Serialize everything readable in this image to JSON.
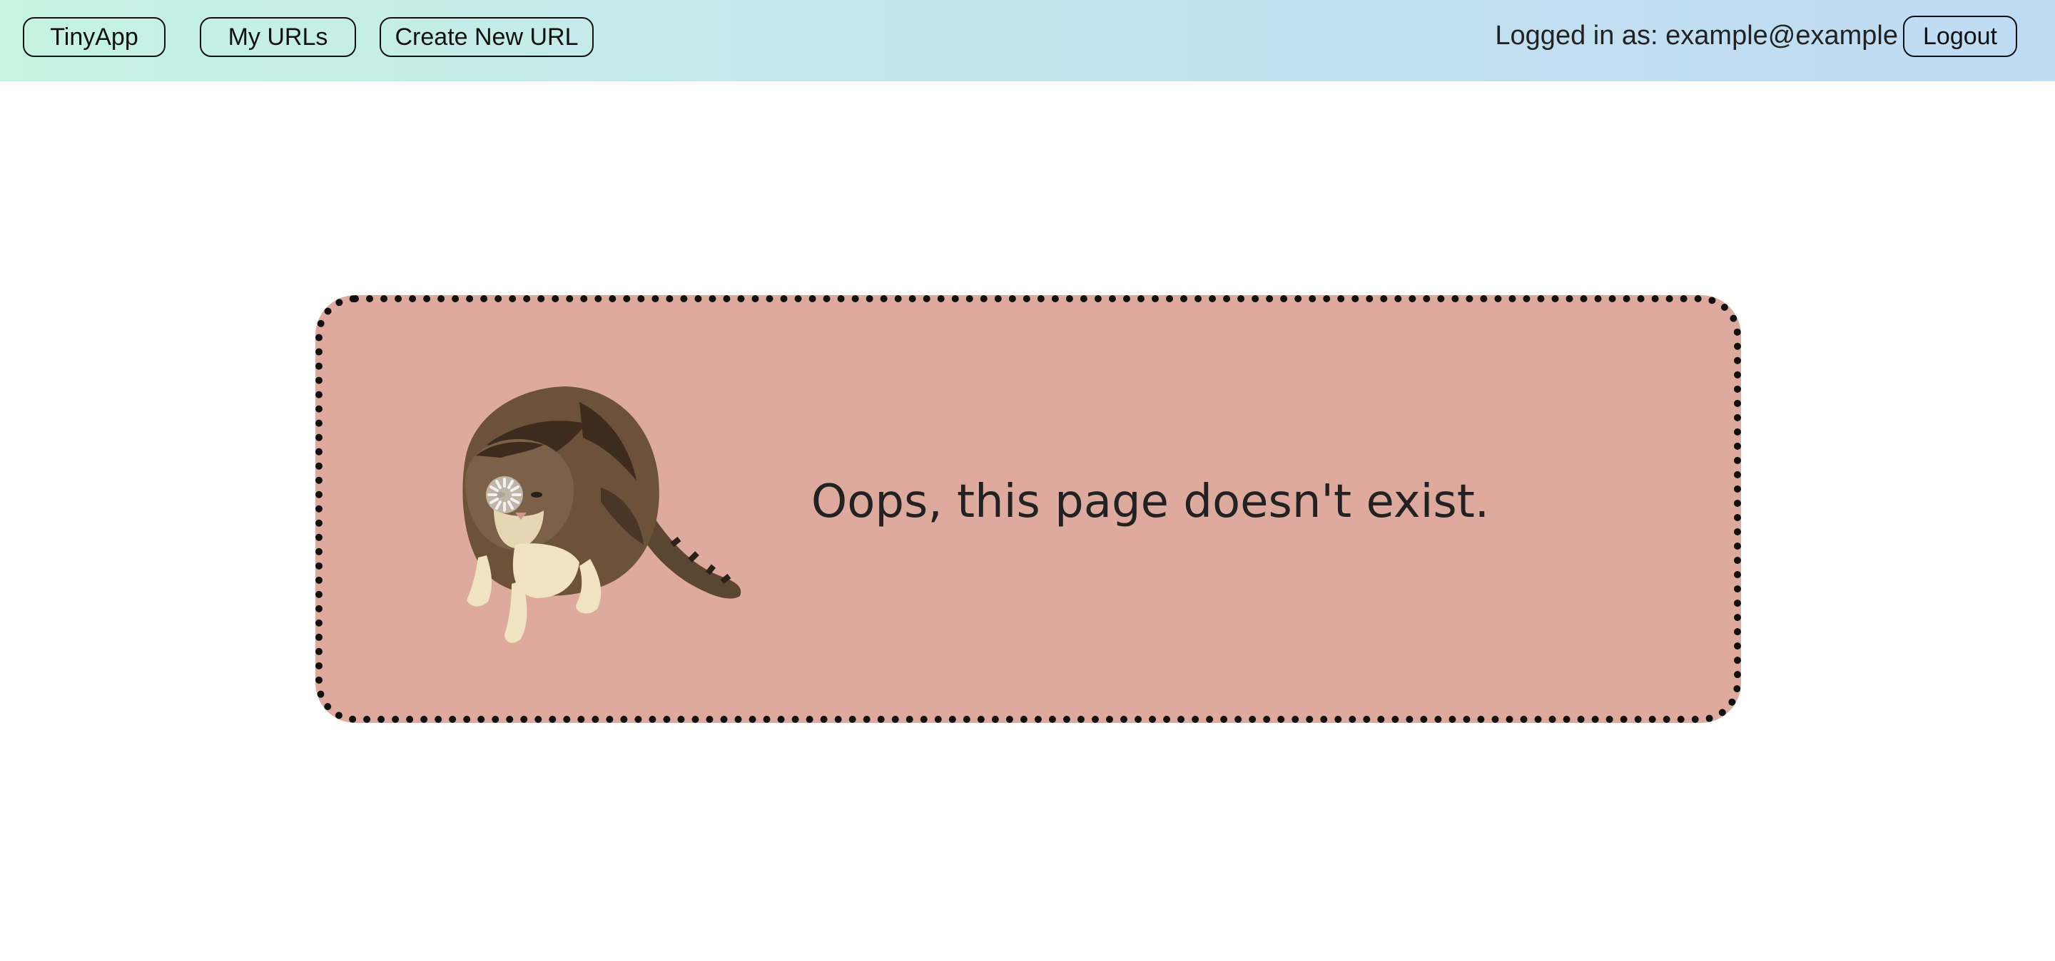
{
  "nav": {
    "brand_label": "TinyApp",
    "my_urls_label": "My URLs",
    "create_label": "Create New URL",
    "logged_in_text": "Logged in as: example@example",
    "logout_label": "Logout"
  },
  "main": {
    "error_message": "Oops, this page doesn't exist.",
    "image_icon": "cat-icon"
  },
  "colors": {
    "navbar_gradient_start": "#c6f3e2",
    "navbar_gradient_end": "#bedbf3",
    "error_box_bg": "#deaa9e",
    "border": "#111111"
  }
}
